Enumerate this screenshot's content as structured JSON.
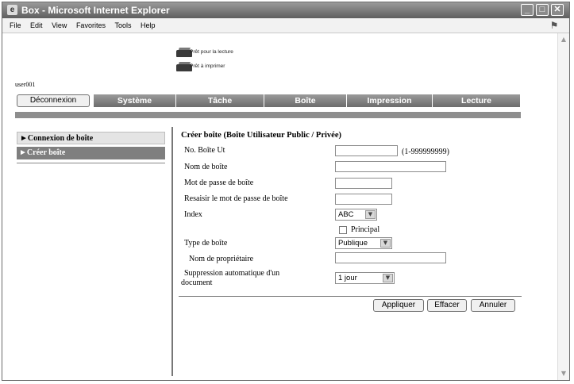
{
  "window": {
    "title": "Box - Microsoft Internet Explorer"
  },
  "menu": {
    "items": [
      "File",
      "Edit",
      "View",
      "Favorites",
      "Tools",
      "Help"
    ]
  },
  "status": {
    "line1": "Prêt pour la lecture",
    "line2": "Prêt à imprimer"
  },
  "user": {
    "name": "user001"
  },
  "logout_label": "Déconnexion",
  "tabs": [
    "Système",
    "Tâche",
    "Boîte",
    "Impression",
    "Lecture"
  ],
  "sidebar": {
    "items": [
      {
        "label": "Connexion de boîte",
        "active": false
      },
      {
        "label": "Créer boîte",
        "active": true
      }
    ]
  },
  "form": {
    "title": "Créer boîte (Boîte Utilisateur Public / Privée)",
    "box_number": {
      "label": "No. Boîte Ut",
      "value": "",
      "hint": "(1-999999999)"
    },
    "box_name": {
      "label": "Nom de boîte",
      "value": ""
    },
    "password": {
      "label": "Mot de passe de boîte",
      "value": ""
    },
    "password_confirm": {
      "label": "Resaisir le mot de passe de boîte",
      "value": ""
    },
    "index": {
      "label": "Index",
      "value": "ABC"
    },
    "principal": {
      "label": "Principal",
      "checked": false
    },
    "box_type": {
      "label": "Type de boîte",
      "value": "Publique"
    },
    "owner": {
      "label": "Nom de propriétaire",
      "value": ""
    },
    "auto_delete": {
      "label_line1": "Suppression automatique d'un",
      "label_line2": "document",
      "value": "1 jour"
    }
  },
  "buttons": {
    "apply": "Appliquer",
    "clear": "Effacer",
    "cancel": "Annuler"
  },
  "colors": {
    "tab_bg": "#808080",
    "sidebar_active_bg": "#7f7f7f",
    "sidebar_bg": "#e4e4e4"
  }
}
